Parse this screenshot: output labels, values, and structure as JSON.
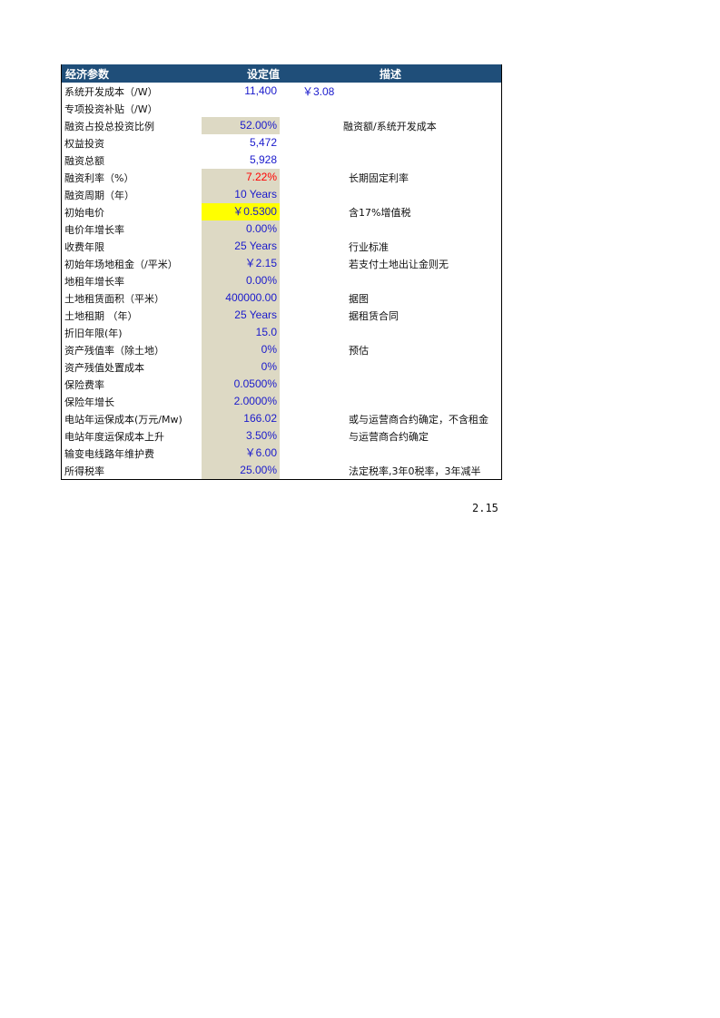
{
  "header": {
    "param": "经济参数",
    "value": "设定值",
    "desc": "描述"
  },
  "rows": [
    {
      "name": "系统开发成本（/W）",
      "value": "11,400",
      "extra": "￥3.08",
      "desc": ""
    },
    {
      "name": "专项投资补贴（/W）",
      "value": "",
      "extra": "",
      "desc": ""
    },
    {
      "name": "融资占投总投资比例",
      "value": "52.00%",
      "extra": "",
      "desc": "融资额/系统开发成本"
    },
    {
      "name": "权益投资",
      "value": "5,472",
      "extra": "",
      "desc": ""
    },
    {
      "name": "融资总额",
      "value": "5,928",
      "extra": "",
      "desc": ""
    },
    {
      "name": "融资利率（%）",
      "value": "7.22%",
      "extra": "",
      "desc": "长期固定利率"
    },
    {
      "name": "融资周期（年）",
      "value": "10 Years",
      "extra": "",
      "desc": ""
    },
    {
      "name": "初始电价",
      "value": "￥0.5300",
      "extra": "",
      "desc": "含17%增值税"
    },
    {
      "name": "电价年增长率",
      "value": "0.00%",
      "extra": "",
      "desc": ""
    },
    {
      "name": "收费年限",
      "value": "25 Years",
      "extra": "",
      "desc": "行业标准"
    },
    {
      "name": "初始年场地租金（/平米）",
      "value": "￥2.15",
      "extra": "",
      "desc": "若支付土地出让金则无"
    },
    {
      "name": "地租年增长率",
      "value": "0.00%",
      "extra": "",
      "desc": ""
    },
    {
      "name": "土地租赁面积（平米）",
      "value": "400000.00",
      "extra": "",
      "desc": "据图"
    },
    {
      "name": "土地租期 （年）",
      "value": "25 Years",
      "extra": "",
      "desc": "据租赁合同"
    },
    {
      "name": "折旧年限(年)",
      "value": "15.0",
      "extra": "",
      "desc": ""
    },
    {
      "name": "资产残值率（除土地）",
      "value": "0%",
      "extra": "",
      "desc": "预估"
    },
    {
      "name": "资产残值处置成本",
      "value": "0%",
      "extra": "",
      "desc": ""
    },
    {
      "name": "保险费率",
      "value": "0.0500%",
      "extra": "",
      "desc": ""
    },
    {
      "name": "保险年增长",
      "value": "2.0000%",
      "extra": "",
      "desc": ""
    },
    {
      "name": "电站年运保成本(万元/Mw)",
      "value": "166.02",
      "extra": "",
      "desc": "或与运营商合约确定，不含租金"
    },
    {
      "name": "电站年度运保成本上升",
      "value": "3.50%",
      "extra": "",
      "desc": "与运营商合约确定"
    },
    {
      "name": "输变电线路年维护费",
      "value": "￥6.00",
      "extra": "",
      "desc": ""
    },
    {
      "name": "所得税率",
      "value": "25.00%",
      "extra": "",
      "desc": "法定税率,3年0税率，3年减半"
    }
  ],
  "footer_value": "2.15",
  "colors": {
    "header_bg": "#1f4e79",
    "input_shade": "#ddd9c4",
    "highlight": "#ffff00",
    "value_blue": "#1a1acc",
    "value_red": "#ff0000"
  }
}
